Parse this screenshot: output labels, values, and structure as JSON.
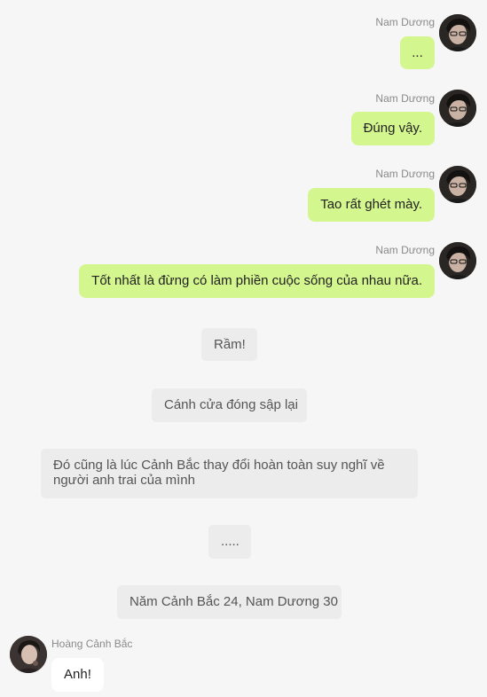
{
  "messages": [
    {
      "sender": "Nam Dương",
      "text": "..."
    },
    {
      "sender": "Nam Dương",
      "text": "Đúng vậy."
    },
    {
      "sender": "Nam Dương",
      "text": "Tao rất ghét mày."
    },
    {
      "sender": "Nam Dương",
      "text": "Tốt nhất là đừng có làm phiền cuộc sống của nhau nữa."
    }
  ],
  "narrations": [
    "Rầm!",
    "Cánh cửa đóng sập lại",
    "Đó cũng là lúc Cảnh Bắc thay đổi hoàn toàn suy nghĩ về người anh trai của mình",
    ".....",
    "Năm Cảnh Bắc 24, Nam Dương 30"
  ],
  "incoming": {
    "sender": "Hoàng Cảnh Bắc",
    "text": "Anh!"
  },
  "colors": {
    "background": "#f6f6f6",
    "outgoing_bubble": "#d4f68f",
    "incoming_bubble": "#ffffff",
    "narration_bubble": "#ececec",
    "sender_name": "#8a8a8a"
  },
  "icons": {
    "outgoing_avatar": "avatar-nam-duong-icon",
    "incoming_avatar": "avatar-hoang-canh-bac-icon"
  }
}
